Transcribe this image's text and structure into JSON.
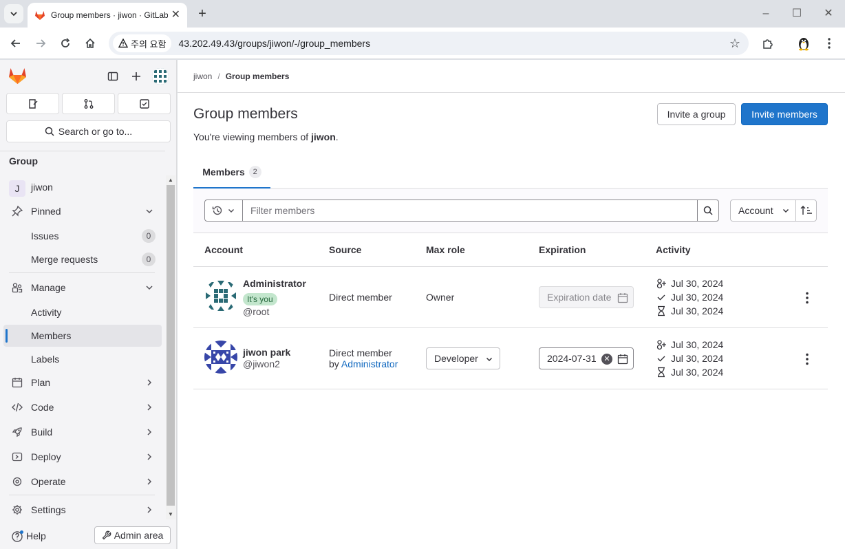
{
  "browser": {
    "tab_title": "Group members · jiwon · GitLab",
    "warning_label": "주의 요함",
    "url": "43.202.49.43/groups/jiwon/-/group_members"
  },
  "sidebar": {
    "search_label": "Search or go to...",
    "section_title": "Group",
    "group_letter": "J",
    "group_name": "jiwon",
    "pinned_label": "Pinned",
    "issues_label": "Issues",
    "issues_count": "0",
    "merge_requests_label": "Merge requests",
    "merge_requests_count": "0",
    "manage_label": "Manage",
    "activity_label": "Activity",
    "members_label": "Members",
    "labels_label": "Labels",
    "plan_label": "Plan",
    "code_label": "Code",
    "build_label": "Build",
    "deploy_label": "Deploy",
    "operate_label": "Operate",
    "settings_label": "Settings",
    "help_label": "Help",
    "admin_label": "Admin area"
  },
  "breadcrumb": {
    "group": "jiwon",
    "current": "Group members"
  },
  "page": {
    "title": "Group members",
    "subtitle_prefix": "You're viewing members of ",
    "subtitle_group": "jiwon",
    "subtitle_suffix": ".",
    "invite_group_label": "Invite a group",
    "invite_members_label": "Invite members"
  },
  "tabs": {
    "members_label": "Members",
    "members_count": "2"
  },
  "filter": {
    "placeholder": "Filter members",
    "sort_label": "Account"
  },
  "table": {
    "columns": [
      "Account",
      "Source",
      "Max role",
      "Expiration",
      "Activity"
    ],
    "rows": [
      {
        "name": "Administrator",
        "badge": "It's you",
        "handle": "@root",
        "source": "Direct member",
        "source_by": "",
        "source_link": "",
        "role": "Owner",
        "expiration": "Expiration date",
        "activity": [
          "Jul 30, 2024",
          "Jul 30, 2024",
          "Jul 30, 2024"
        ]
      },
      {
        "name": "jiwon park",
        "badge": "",
        "handle": "@jiwon2",
        "source": "Direct member",
        "source_by": "by ",
        "source_link": "Administrator",
        "role": "Developer",
        "expiration": "2024-07-31",
        "activity": [
          "Jul 30, 2024",
          "Jul 30, 2024",
          "Jul 30, 2024"
        ]
      }
    ]
  },
  "colors": {
    "primary": "#1f75cb",
    "sidebar_bg": "#f4f4f6",
    "badge_bg": "#c3e6cd",
    "avatar_admin": "#2a6a75",
    "avatar_jiwon": "#3746a8"
  }
}
